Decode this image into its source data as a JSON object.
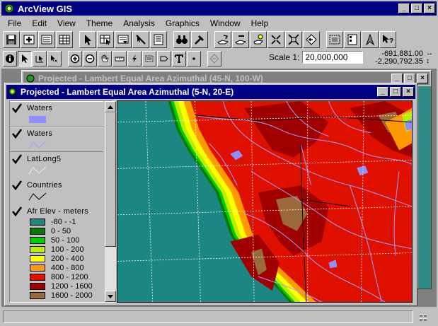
{
  "app": {
    "title": "ArcView GIS",
    "controls": {
      "minimize": "_",
      "maximize": "□",
      "close": "×"
    }
  },
  "menu": [
    "File",
    "Edit",
    "View",
    "Theme",
    "Analysis",
    "Graphics",
    "Window",
    "Help"
  ],
  "toolbar": {
    "scale_label": "Scale 1:",
    "scale_value": "20,000,000",
    "coord_x": "-691,881.00",
    "coord_y": "-2,290,792.35"
  },
  "back_window": {
    "title": "Projected - Lambert Equal Area Azimuthal (45-N, 100-W)"
  },
  "front_window": {
    "title": "Projected - Lambert Equal Area Azimuthal  (5-N, 20-E)"
  },
  "themes": [
    {
      "name": "Waters",
      "checked": true,
      "symbol": "polygon",
      "color": "#8f8fff"
    },
    {
      "name": "Waters",
      "checked": true,
      "symbol": "line",
      "color": "#9fa0ff"
    },
    {
      "name": "LatLong5",
      "checked": true,
      "symbol": "dashed-line",
      "color": "#ffffff"
    },
    {
      "name": "Countries",
      "checked": true,
      "symbol": "line",
      "color": "#000000"
    },
    {
      "name": "Afr Elev - meters",
      "checked": true,
      "symbol": "ramp",
      "classes": [
        {
          "label": "-80 - -1",
          "color": "#1c8682"
        },
        {
          "label": "0 - 50",
          "color": "#007a00"
        },
        {
          "label": "50 - 100",
          "color": "#00cc00"
        },
        {
          "label": "100 - 200",
          "color": "#b8f000"
        },
        {
          "label": "200 - 400",
          "color": "#ffff00"
        },
        {
          "label": "400 - 800",
          "color": "#ff9900"
        },
        {
          "label": "800 - 1200",
          "color": "#e01000"
        },
        {
          "label": "1200 - 1600",
          "color": "#a00000"
        },
        {
          "label": "1600 - 2000",
          "color": "#9a6a3a"
        }
      ]
    }
  ]
}
